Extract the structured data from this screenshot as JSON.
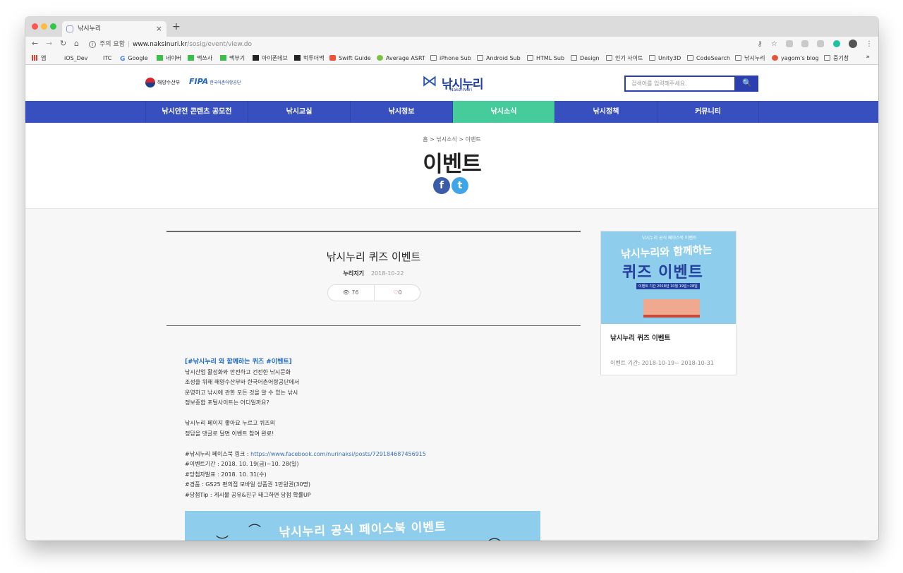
{
  "browser": {
    "tab_title": "낚시누리",
    "new_tab": "+",
    "tab_close": "×",
    "security_label": "주의 요함",
    "url_host": "www.naksinuri.kr",
    "url_path": "/sosig/event/view.do",
    "nav": {
      "back": "←",
      "forward": "→",
      "reload": "↻",
      "home": "⌂"
    },
    "toolbar_icons": [
      "key-icon",
      "star-icon",
      "extension-icon",
      "extension-icon",
      "extension-icon",
      "extension-icon",
      "avatar-icon",
      "menu-icon"
    ],
    "bookmarks": [
      "앱",
      "iOS_Dev",
      "ITC",
      "Google",
      "네이버",
      "맥쓰사",
      "맥부기",
      "아이폰데브",
      "벅투더맥",
      "Swift Guide",
      "Average ASRT",
      "iPhone Sub",
      "Android Sub",
      "HTML Sub",
      "Design",
      "인기 사이트",
      "Unity3D",
      "CodeSearch",
      "낚시누리",
      "yagom's blog",
      "중기청"
    ],
    "bookmarks_more": "»"
  },
  "header": {
    "gov_name": "해양수산부",
    "fipa_mark": "FIPA",
    "fipa_name": "한국어촌어항공단",
    "logo_name": "낚시누리",
    "logo_sub": "Naksi-Nuri",
    "search_placeholder": "검색어를 입력해주세요.",
    "search_icon": "🔍"
  },
  "gnb": [
    {
      "label": "낚시안전 콘텐츠 공모전",
      "active": false
    },
    {
      "label": "낚시교실",
      "active": false
    },
    {
      "label": "낚시정보",
      "active": false
    },
    {
      "label": "낚시소식",
      "active": true
    },
    {
      "label": "낚시정책",
      "active": false
    },
    {
      "label": "커뮤니티",
      "active": false
    }
  ],
  "page": {
    "breadcrumb": "홈 > 낚시소식 > 이벤트",
    "title": "이벤트",
    "facebook": "f",
    "twitter": "t"
  },
  "post": {
    "title": "낚시누리 퀴즈 이벤트",
    "author": "누리지기",
    "date": "2018-10-22",
    "views": "76",
    "likes": "0",
    "headline": "[#낚시누리 와 함께하는 퀴즈 #이벤트]",
    "p1": [
      "낚시산업 활성화와 안전하고 건전한 낚시문화",
      "조성을 위해 해양수산부와 한국어촌어항공단에서",
      "운영하고 낚시에 관한 모든 것을 알 수 있는 낚시",
      "정보종합 포털사이트는 어디일까요?"
    ],
    "p2": [
      "낚시누리 페이지 좋아요 누르고 퀴즈의",
      "정답을 댓글로 달면 이벤트 참여 완료!"
    ],
    "link_label": "#낚시누리 페이스북 링크 : ",
    "link_url": "https://www.facebook.com/nurinaksi/posts/729184687456915",
    "details": [
      "#이벤트기간 : 2018. 10. 19(금)~10. 28(일)",
      "#당첨자발표 : 2018. 10. 31(수)",
      "#경품 : GS25 편의점 모바일 상품권 1만원권(30명)",
      "#당첨Tip : 게시물 공유&친구 태그하면 당첨 확률UP"
    ],
    "banner_title": "낚시누리 공식 페이스북 이벤트"
  },
  "card": {
    "img_top": "낚시누리 공식 페이스북 이벤트",
    "img_line1": "낚시누리와 함께하는",
    "img_line2": "퀴즈 이벤트",
    "img_date": "이벤트 기간 2018년 10월 19일~28일",
    "title": "낚시누리 퀴즈 이벤트",
    "period": "이벤트 기간: 2018-10-19~ 2018-10-31"
  },
  "colors": {
    "gnb": "#3850bf",
    "active": "#46cc9a",
    "accent": "#2c3fb1",
    "link": "#1c67c2"
  }
}
